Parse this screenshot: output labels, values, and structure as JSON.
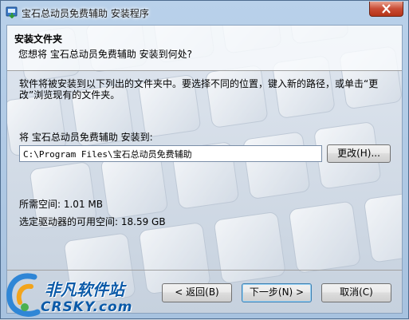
{
  "window": {
    "title": "宝石总动员免费辅助 安装程序"
  },
  "header": {
    "title": "安装文件夹",
    "subtitle": "您想将 宝石总动员免费辅助 安装到何处?"
  },
  "body": {
    "description": "软件将被安装到以下列出的文件夹中。要选择不同的位置，键入新的路径，或单击“更改”浏览现有的文件夹。",
    "install_to_label": "将 宝石总动员免费辅助 安装到:",
    "install_path": "C:\\Program Files\\宝石总动员免费辅助",
    "change_button": "更改(H)...",
    "space_required": "所需空间: 1.01 MB",
    "space_available": "选定驱动器的可用空间: 18.59 GB"
  },
  "footer": {
    "back_button": "< 返回(B)",
    "next_button": "下一步(N) >",
    "cancel_button": "取消(C)"
  },
  "watermark": {
    "line1": "非凡软件站",
    "line2": "CRSKY.com"
  },
  "colors": {
    "frame": "#b9d1ea",
    "close_button": "#c94c35",
    "watermark": "#0b5aa8"
  },
  "icons": [
    "installer-app-icon",
    "close-icon",
    "keyboard-background-image",
    "crsky-logo-icon"
  ]
}
